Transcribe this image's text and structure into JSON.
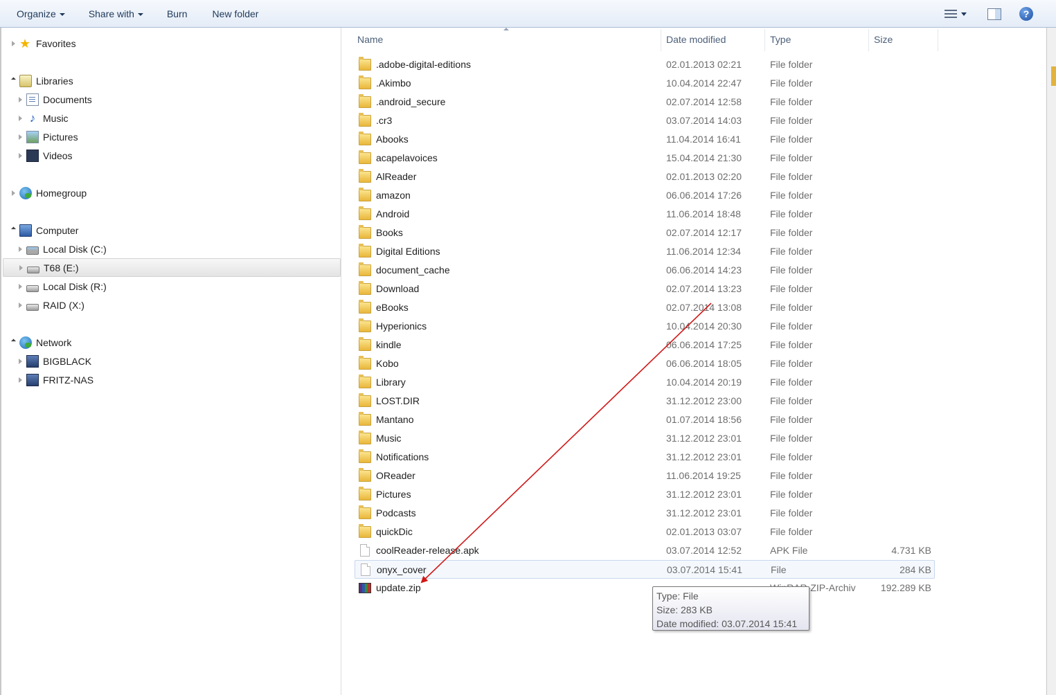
{
  "toolbar": {
    "organize": "Organize",
    "share_with": "Share with",
    "burn": "Burn",
    "new_folder": "New folder",
    "help_glyph": "?"
  },
  "nav": {
    "favorites": "Favorites",
    "libraries": "Libraries",
    "documents": "Documents",
    "music": "Music",
    "pictures": "Pictures",
    "videos": "Videos",
    "homegroup": "Homegroup",
    "computer": "Computer",
    "local_disk_c": "Local Disk (C:)",
    "t68": "T68 (E:)",
    "local_disk_r": "Local Disk (R:)",
    "raid": "RAID (X:)",
    "network": "Network",
    "bigblack": "BIGBLACK",
    "fritz_nas": "FRITZ-NAS"
  },
  "columns": {
    "name": "Name",
    "date_modified": "Date modified",
    "type": "Type",
    "size": "Size"
  },
  "files": [
    {
      "name": ".adobe-digital-editions",
      "date": "02.01.2013 02:21",
      "type": "File folder",
      "size": "",
      "icon": "folder"
    },
    {
      "name": ".Akimbo",
      "date": "10.04.2014 22:47",
      "type": "File folder",
      "size": "",
      "icon": "folder"
    },
    {
      "name": ".android_secure",
      "date": "02.07.2014 12:58",
      "type": "File folder",
      "size": "",
      "icon": "folder"
    },
    {
      "name": ".cr3",
      "date": "03.07.2014 14:03",
      "type": "File folder",
      "size": "",
      "icon": "folder"
    },
    {
      "name": "Abooks",
      "date": "11.04.2014 16:41",
      "type": "File folder",
      "size": "",
      "icon": "folder"
    },
    {
      "name": "acapelavoices",
      "date": "15.04.2014 21:30",
      "type": "File folder",
      "size": "",
      "icon": "folder"
    },
    {
      "name": "AlReader",
      "date": "02.01.2013 02:20",
      "type": "File folder",
      "size": "",
      "icon": "folder"
    },
    {
      "name": "amazon",
      "date": "06.06.2014 17:26",
      "type": "File folder",
      "size": "",
      "icon": "folder"
    },
    {
      "name": "Android",
      "date": "11.06.2014 18:48",
      "type": "File folder",
      "size": "",
      "icon": "folder"
    },
    {
      "name": "Books",
      "date": "02.07.2014 12:17",
      "type": "File folder",
      "size": "",
      "icon": "folder"
    },
    {
      "name": "Digital Editions",
      "date": "11.06.2014 12:34",
      "type": "File folder",
      "size": "",
      "icon": "folder"
    },
    {
      "name": "document_cache",
      "date": "06.06.2014 14:23",
      "type": "File folder",
      "size": "",
      "icon": "folder"
    },
    {
      "name": "Download",
      "date": "02.07.2014 13:23",
      "type": "File folder",
      "size": "",
      "icon": "folder"
    },
    {
      "name": "eBooks",
      "date": "02.07.2014 13:08",
      "type": "File folder",
      "size": "",
      "icon": "folder"
    },
    {
      "name": "Hyperionics",
      "date": "10.04.2014 20:30",
      "type": "File folder",
      "size": "",
      "icon": "folder"
    },
    {
      "name": "kindle",
      "date": "06.06.2014 17:25",
      "type": "File folder",
      "size": "",
      "icon": "folder"
    },
    {
      "name": "Kobo",
      "date": "06.06.2014 18:05",
      "type": "File folder",
      "size": "",
      "icon": "folder"
    },
    {
      "name": "Library",
      "date": "10.04.2014 20:19",
      "type": "File folder",
      "size": "",
      "icon": "folder"
    },
    {
      "name": "LOST.DIR",
      "date": "31.12.2012 23:00",
      "type": "File folder",
      "size": "",
      "icon": "folder"
    },
    {
      "name": "Mantano",
      "date": "01.07.2014 18:56",
      "type": "File folder",
      "size": "",
      "icon": "folder"
    },
    {
      "name": "Music",
      "date": "31.12.2012 23:01",
      "type": "File folder",
      "size": "",
      "icon": "folder"
    },
    {
      "name": "Notifications",
      "date": "31.12.2012 23:01",
      "type": "File folder",
      "size": "",
      "icon": "folder"
    },
    {
      "name": "OReader",
      "date": "11.06.2014 19:25",
      "type": "File folder",
      "size": "",
      "icon": "folder"
    },
    {
      "name": "Pictures",
      "date": "31.12.2012 23:01",
      "type": "File folder",
      "size": "",
      "icon": "folder"
    },
    {
      "name": "Podcasts",
      "date": "31.12.2012 23:01",
      "type": "File folder",
      "size": "",
      "icon": "folder"
    },
    {
      "name": "quickDic",
      "date": "02.01.2013 03:07",
      "type": "File folder",
      "size": "",
      "icon": "folder"
    },
    {
      "name": "coolReader-release.apk",
      "date": "03.07.2014 12:52",
      "type": "APK File",
      "size": "4.731 KB",
      "icon": "file"
    },
    {
      "name": "onyx_cover",
      "date": "03.07.2014 15:41",
      "type": "File",
      "size": "284 KB",
      "icon": "file",
      "selected": true
    },
    {
      "name": "update.zip",
      "date": "",
      "type": "WinRAR-ZIP-Archiv",
      "size": "192.289 KB",
      "icon": "zip"
    }
  ],
  "tooltip": {
    "type": "Type: File",
    "size": "Size: 283 KB",
    "date": "Date modified: 03.07.2014 15:41"
  },
  "colors": {
    "annotation_arrow": "#d01818",
    "toolbar_text": "#1e395b",
    "header_text": "#4c607a"
  }
}
